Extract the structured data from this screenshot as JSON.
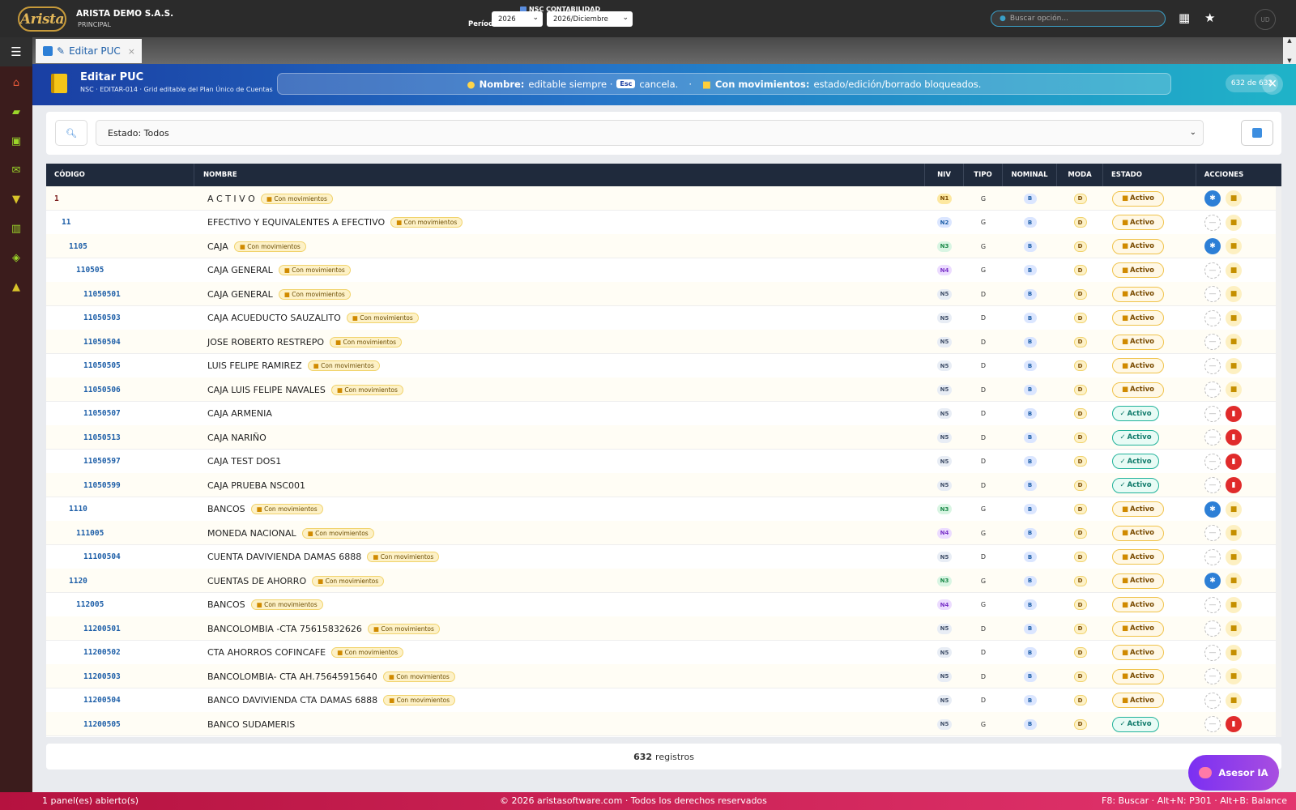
{
  "header": {
    "logo_text": "Arista",
    "company": "ARISTA DEMO S.A.S.",
    "company_sub": "PRINCIPAL",
    "module": "NSC CONTABILIDAD",
    "period_label": "Período:",
    "year": "2026",
    "month": "2026/Diciembre",
    "search_placeholder": "Buscar opción...",
    "avatar": "UD"
  },
  "tab": {
    "label": "Editar PUC",
    "close": "×"
  },
  "banner": {
    "title": "Editar PUC",
    "subtitle": "NSC · EDITAR-014 · Grid editable del Plan Único de Cuentas",
    "info_a_bold": "Nombre:",
    "info_a": "editable siempre ·",
    "info_kbd": "Esc",
    "info_a_end": "cancela.",
    "info_sep": "·",
    "info_b_bold": "Con movimientos:",
    "info_b": "estado/edición/borrado bloqueados.",
    "count": "632 de 632"
  },
  "filter": {
    "estado": "Estado: Todos"
  },
  "columns": {
    "codigo": "CÓDIGO",
    "nombre": "NOMBRE",
    "niv": "NIV",
    "tipo": "TIPO",
    "nominal": "NOMINAL",
    "moda": "MODA",
    "estado": "ESTADO",
    "acciones": "ACCIONES"
  },
  "labels": {
    "con_mov": "Con movimientos",
    "activo": "Activo",
    "nominal": "B",
    "moda": "D"
  },
  "colors": {
    "n1": "#fde8a0",
    "n2": "#dbe6ff",
    "n3": "#d9f5e3",
    "n4": "#ecdcff",
    "n5": "#e8edf5"
  },
  "rows": [
    {
      "code": "1",
      "indent": 0,
      "name": "A C T I V O",
      "mov": true,
      "niv": "N1",
      "tipo": "G",
      "action": "gear"
    },
    {
      "code": "11",
      "indent": 1,
      "name": "EFECTIVO Y EQUIVALENTES A EFECTIVO",
      "mov": true,
      "niv": "N2",
      "tipo": "G",
      "action": "dash"
    },
    {
      "code": "1105",
      "indent": 2,
      "name": "CAJA",
      "mov": true,
      "niv": "N3",
      "tipo": "G",
      "action": "gear"
    },
    {
      "code": "110505",
      "indent": 3,
      "name": "CAJA GENERAL",
      "mov": true,
      "niv": "N4",
      "tipo": "G",
      "action": "dash"
    },
    {
      "code": "11050501",
      "indent": 4,
      "name": "CAJA GENERAL",
      "mov": true,
      "niv": "N5",
      "tipo": "D",
      "action": "dash"
    },
    {
      "code": "11050503",
      "indent": 4,
      "name": "CAJA ACUEDUCTO SAUZALITO",
      "mov": true,
      "niv": "N5",
      "tipo": "D",
      "action": "dash"
    },
    {
      "code": "11050504",
      "indent": 4,
      "name": "JOSE ROBERTO RESTREPO",
      "mov": true,
      "niv": "N5",
      "tipo": "D",
      "action": "dash"
    },
    {
      "code": "11050505",
      "indent": 4,
      "name": "LUIS FELIPE RAMIREZ",
      "mov": true,
      "niv": "N5",
      "tipo": "D",
      "action": "dash"
    },
    {
      "code": "11050506",
      "indent": 4,
      "name": "CAJA LUIS FELIPE NAVALES",
      "mov": true,
      "niv": "N5",
      "tipo": "D",
      "action": "dash"
    },
    {
      "code": "11050507",
      "indent": 4,
      "name": "CAJA ARMENIA",
      "mov": false,
      "niv": "N5",
      "tipo": "D",
      "action": "dash"
    },
    {
      "code": "11050513",
      "indent": 4,
      "name": "CAJA NARIÑO",
      "mov": false,
      "niv": "N5",
      "tipo": "D",
      "action": "dash"
    },
    {
      "code": "11050597",
      "indent": 4,
      "name": "CAJA TEST DOS1",
      "mov": false,
      "niv": "N5",
      "tipo": "D",
      "action": "dash"
    },
    {
      "code": "11050599",
      "indent": 4,
      "name": "CAJA PRUEBA NSC001",
      "mov": false,
      "niv": "N5",
      "tipo": "D",
      "action": "dash"
    },
    {
      "code": "1110",
      "indent": 2,
      "name": "BANCOS",
      "mov": true,
      "niv": "N3",
      "tipo": "G",
      "action": "gear"
    },
    {
      "code": "111005",
      "indent": 3,
      "name": "MONEDA NACIONAL",
      "mov": true,
      "niv": "N4",
      "tipo": "G",
      "action": "dash"
    },
    {
      "code": "11100504",
      "indent": 4,
      "name": "CUENTA DAVIVIENDA DAMAS 6888",
      "mov": true,
      "niv": "N5",
      "tipo": "D",
      "action": "dash"
    },
    {
      "code": "1120",
      "indent": 2,
      "name": "CUENTAS DE AHORRO",
      "mov": true,
      "niv": "N3",
      "tipo": "G",
      "action": "gear"
    },
    {
      "code": "112005",
      "indent": 3,
      "name": "BANCOS",
      "mov": true,
      "niv": "N4",
      "tipo": "G",
      "action": "dash"
    },
    {
      "code": "11200501",
      "indent": 4,
      "name": "BANCOLOMBIA -CTA 75615832626",
      "mov": true,
      "niv": "N5",
      "tipo": "D",
      "action": "dash"
    },
    {
      "code": "11200502",
      "indent": 4,
      "name": "CTA AHORROS COFINCAFE",
      "mov": true,
      "niv": "N5",
      "tipo": "D",
      "action": "dash"
    },
    {
      "code": "11200503",
      "indent": 4,
      "name": "BANCOLOMBIA- CTA AH.75645915640",
      "mov": true,
      "niv": "N5",
      "tipo": "D",
      "action": "dash"
    },
    {
      "code": "11200504",
      "indent": 4,
      "name": "BANCO DAVIVIENDA CTA DAMAS 6888",
      "mov": true,
      "niv": "N5",
      "tipo": "D",
      "action": "dash"
    },
    {
      "code": "11200505",
      "indent": 4,
      "name": "BANCO SUDAMERIS",
      "mov": false,
      "niv": "N5",
      "tipo": "G",
      "action": "dash"
    }
  ],
  "footer": {
    "count": "632",
    "label": "registros"
  },
  "asesor": "Asesor IA",
  "status": {
    "left": "1 panel(es) abierto(s)",
    "center": "© 2026 aristasoftware.com · Todos los derechos reservados",
    "right": "F8: Buscar · Alt+N: P301 · Alt+B: Balance"
  }
}
